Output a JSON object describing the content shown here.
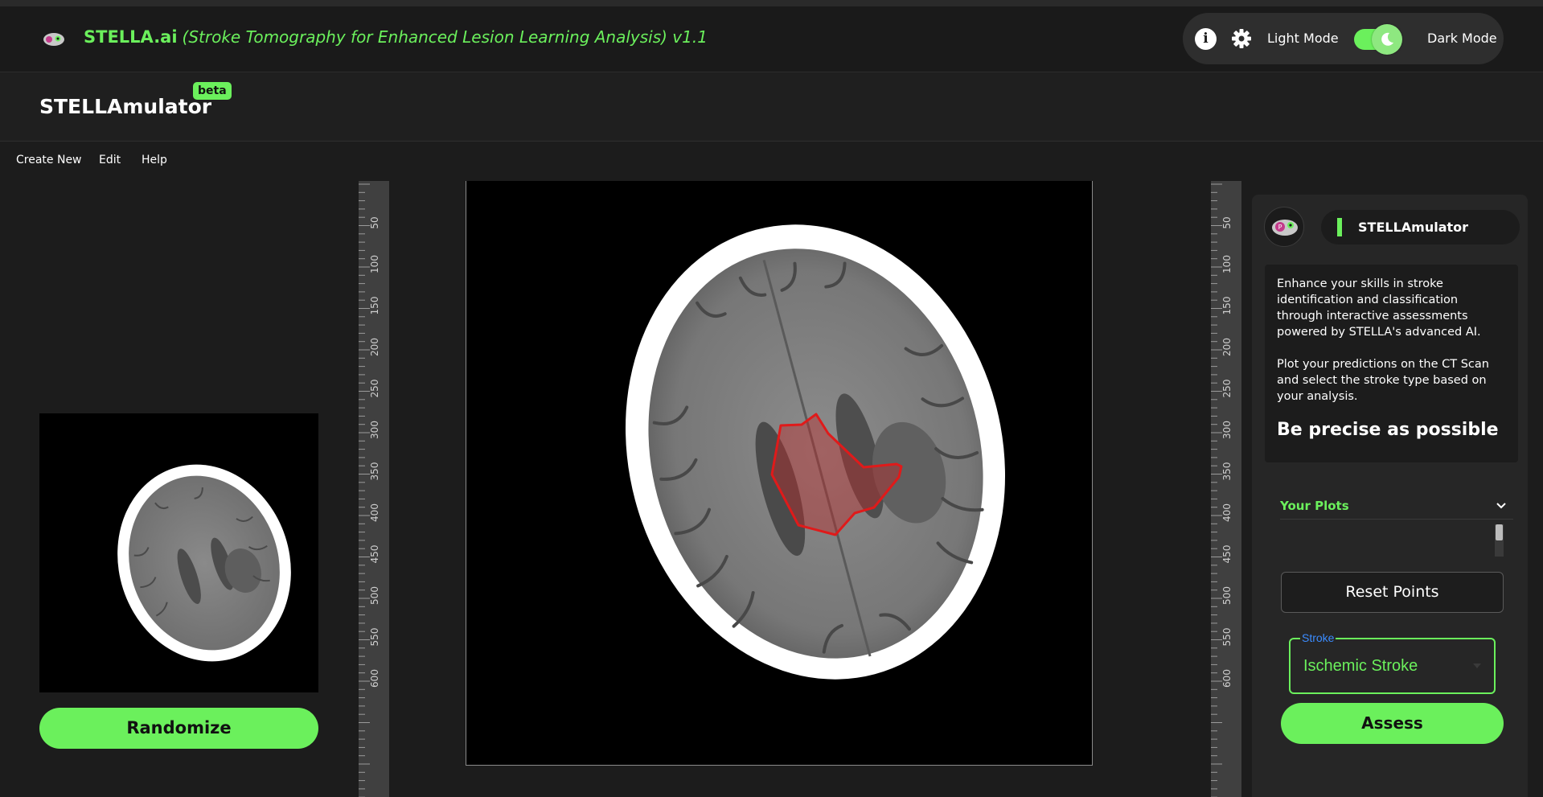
{
  "header": {
    "brand": "STELLA.ai",
    "subtitle": "(Stroke Tomography for Enhanced Lesion Learning Analysis) v1.1",
    "light_mode_label": "Light Mode",
    "dark_mode_label": "Dark Mode",
    "theme_toggle_on": true
  },
  "app": {
    "title": "STELLAmulator",
    "badge": "beta"
  },
  "menu": {
    "items": [
      "Create New",
      "Edit",
      "Help"
    ]
  },
  "left": {
    "randomize_label": "Randomize"
  },
  "ruler": {
    "ticks": [
      "50",
      "100",
      "150",
      "200",
      "250",
      "300",
      "350",
      "400",
      "450",
      "500",
      "550",
      "600"
    ]
  },
  "panel": {
    "chip_label": "STELLAmulator",
    "desc_1": "Enhance your skills in stroke identification and classification through interactive assessments powered by STELLA's advanced AI.",
    "desc_2": "Plot your predictions on the CT Scan and select the stroke type based on your analysis.",
    "precise": "Be precise as possible",
    "plots_label": "Your Plots",
    "reset_label": "Reset Points",
    "stroke_legend": "Stroke",
    "stroke_value": "Ischemic Stroke",
    "assess_label": "Assess"
  },
  "colors": {
    "accent": "#6bf05c",
    "background": "#1c1c1c",
    "panel": "#262626",
    "lesion_outline": "#e01a1a",
    "legend_blue": "#3b8cff"
  },
  "icons": [
    "app-logo-icon",
    "info-icon",
    "gear-icon",
    "moon-icon",
    "chevron-down-icon",
    "caret-down-icon"
  ]
}
